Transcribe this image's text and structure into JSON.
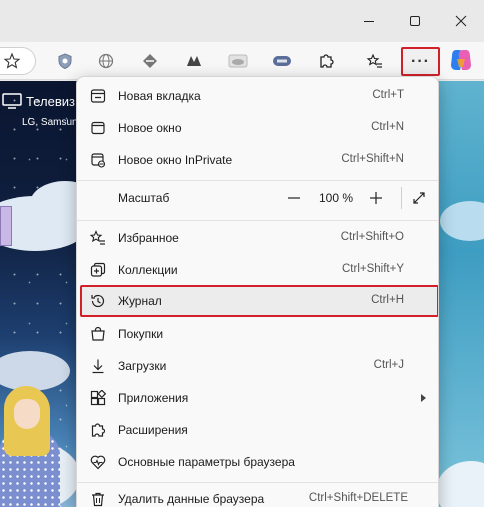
{
  "page": {
    "tv_title": "Телевиз",
    "tv_subtitle": "LG, Samsun"
  },
  "menu": {
    "items": [
      {
        "label": "Новая вкладка",
        "shortcut": "Ctrl+T",
        "icon": "new-tab-icon"
      },
      {
        "label": "Новое окно",
        "shortcut": "Ctrl+N",
        "icon": "new-window-icon"
      },
      {
        "label": "Новое окно InPrivate",
        "shortcut": "Ctrl+Shift+N",
        "icon": "inprivate-icon"
      },
      {
        "label": "Избранное",
        "shortcut": "Ctrl+Shift+O",
        "icon": "favorites-icon"
      },
      {
        "label": "Коллекции",
        "shortcut": "Ctrl+Shift+Y",
        "icon": "collections-icon"
      },
      {
        "label": "Журнал",
        "shortcut": "Ctrl+H",
        "icon": "history-icon"
      },
      {
        "label": "Покупки",
        "shortcut": "",
        "icon": "shopping-icon"
      },
      {
        "label": "Загрузки",
        "shortcut": "Ctrl+J",
        "icon": "downloads-icon"
      },
      {
        "label": "Приложения",
        "shortcut": "",
        "icon": "apps-icon"
      },
      {
        "label": "Расширения",
        "shortcut": "",
        "icon": "extensions-icon"
      },
      {
        "label": "Основные параметры браузера",
        "shortcut": "",
        "icon": "browser-essentials-icon"
      },
      {
        "label": "Удалить данные браузера",
        "shortcut": "Ctrl+Shift+DELETE",
        "icon": "delete-icon"
      }
    ],
    "zoom": {
      "label": "Масштаб",
      "value": "100 %",
      "minus": "—",
      "plus": "+"
    }
  },
  "toolbar": {
    "more_label": "···"
  },
  "colors": {
    "highlight_border": "#d2202a",
    "menu_bg": "#f9f9f9"
  }
}
